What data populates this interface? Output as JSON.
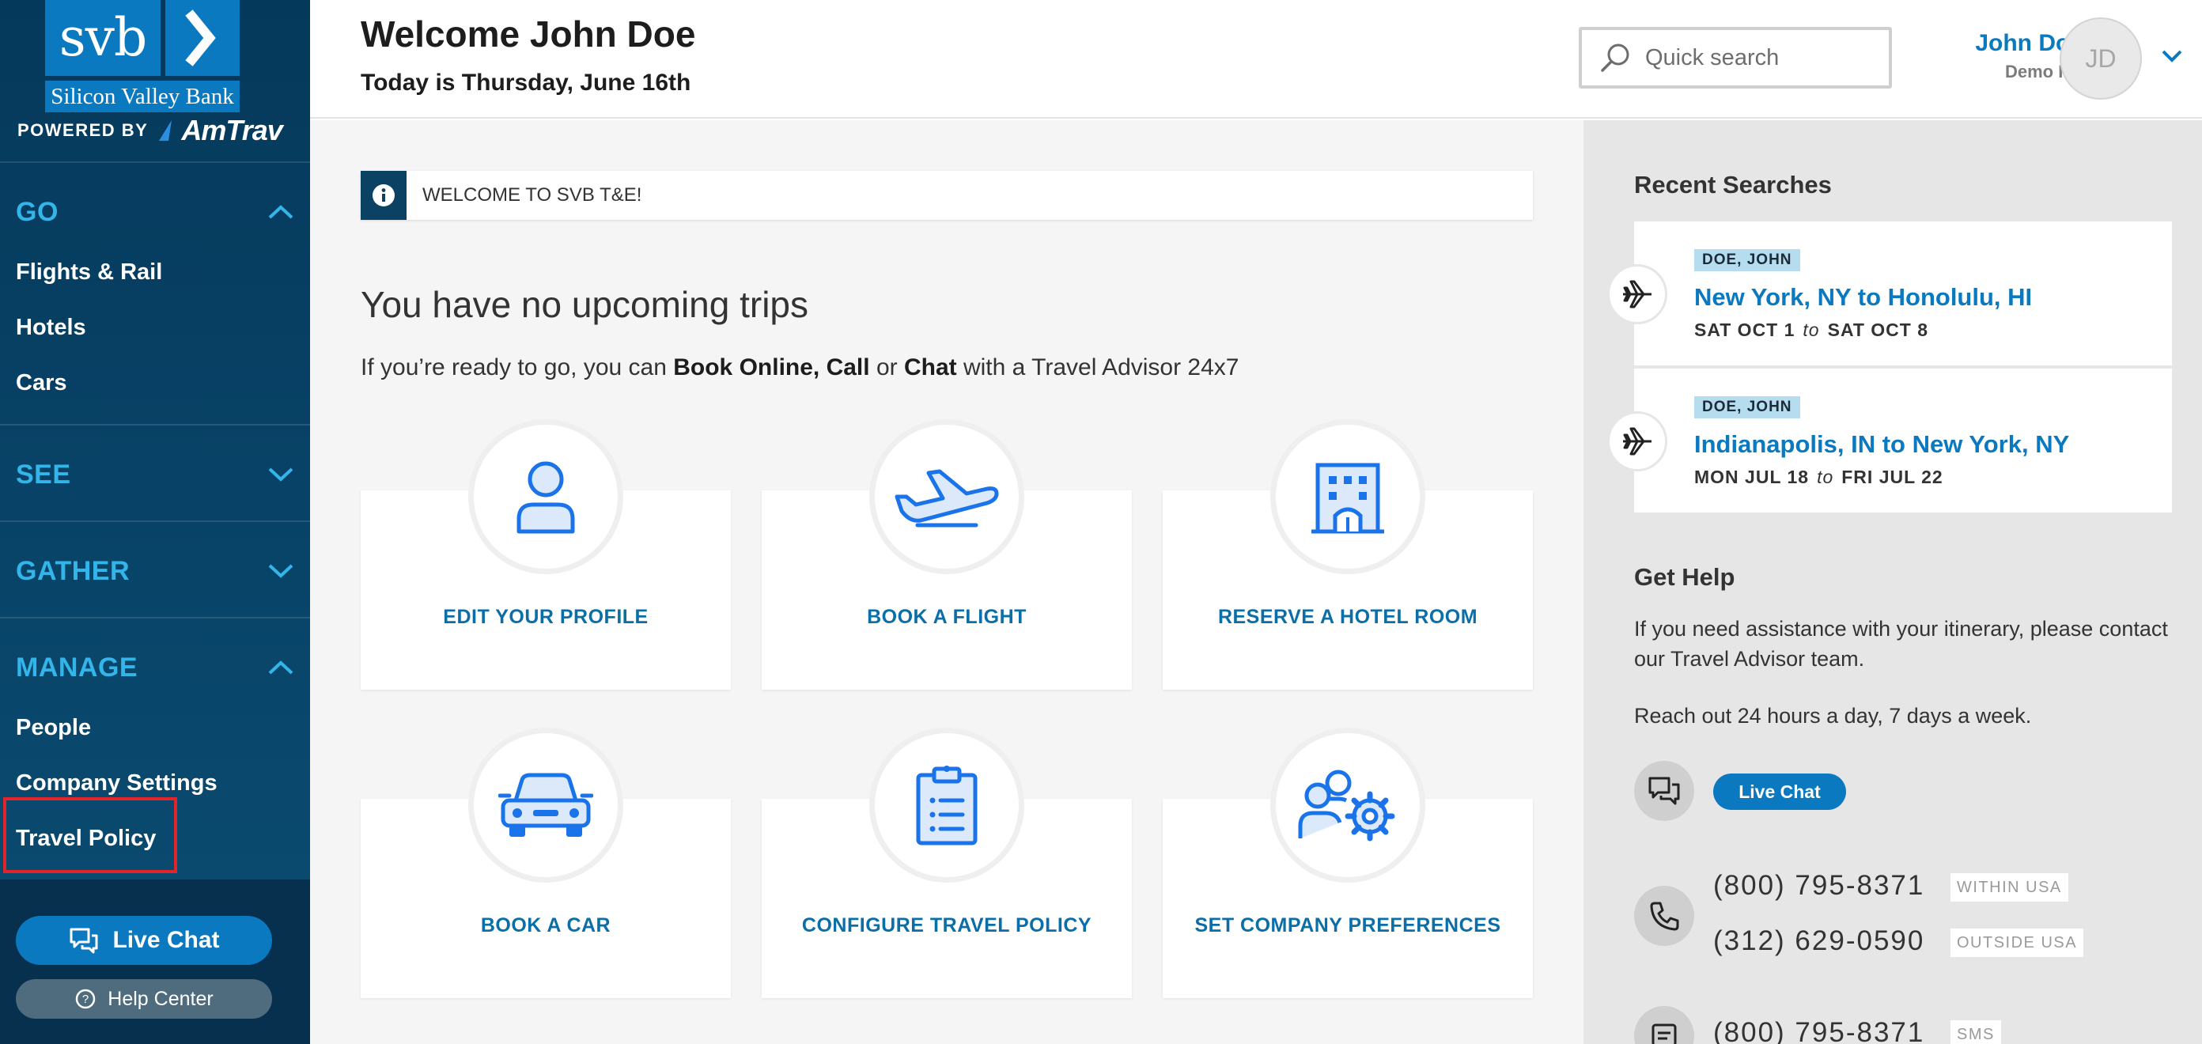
{
  "sidebar": {
    "logo": {
      "mark": "svb",
      "bank_name": "Silicon Valley Bank"
    },
    "powered_by": {
      "label": "POWERED BY",
      "brand": "AmTrav"
    },
    "sections": [
      {
        "title": "GO",
        "expanded": true,
        "items": [
          "Flights & Rail",
          "Hotels",
          "Cars"
        ]
      },
      {
        "title": "SEE",
        "expanded": false,
        "items": []
      },
      {
        "title": "GATHER",
        "expanded": false,
        "items": []
      },
      {
        "title": "MANAGE",
        "expanded": true,
        "items": [
          "People",
          "Company Settings",
          "Travel Policy"
        ]
      }
    ],
    "live_chat_label": "Live Chat",
    "help_center_label": "Help Center",
    "colors": {
      "accent": "#33b5ea",
      "highlight": "#e0262b"
    }
  },
  "header": {
    "welcome": "Welcome John Doe",
    "today": "Today is Thursday, June 16th",
    "search_placeholder": "Quick search",
    "user_name": "John Doe",
    "company": "Demo Inc",
    "avatar_initials": "JD"
  },
  "main": {
    "notice": "WELCOME TO SVB T&E!",
    "no_trips": "You have no upcoming trips",
    "ready": {
      "prefix": "If you’re ready to go, you can ",
      "bold1": "Book Online, Call",
      "mid": " or ",
      "bold2": "Chat",
      "suffix": " with a Travel Advisor 24x7"
    },
    "tiles": [
      {
        "label": "EDIT YOUR PROFILE",
        "icon": "user-icon"
      },
      {
        "label": "BOOK A FLIGHT",
        "icon": "airplane-icon"
      },
      {
        "label": "RESERVE A HOTEL ROOM",
        "icon": "hotel-icon"
      },
      {
        "label": "BOOK A CAR",
        "icon": "car-icon"
      },
      {
        "label": "CONFIGURE TRAVEL POLICY",
        "icon": "clipboard-icon"
      },
      {
        "label": "SET COMPANY PREFERENCES",
        "icon": "users-gear-icon"
      }
    ]
  },
  "right_panel": {
    "recent_title": "Recent Searches",
    "searches": [
      {
        "traveler": "DOE, JOHN",
        "route": "New York, NY to Honolulu, HI",
        "from_date": "SAT OCT 1",
        "to_word": "to",
        "to_date": "SAT OCT 8"
      },
      {
        "traveler": "DOE, JOHN",
        "route": "Indianapolis, IN to New York, NY",
        "from_date": "MON JUL 18",
        "to_word": "to",
        "to_date": "FRI JUL 22"
      }
    ],
    "help_title": "Get Help",
    "help_text": "If you need assistance with your itinerary, please contact our Travel Advisor team.",
    "reach_out": "Reach out 24 hours a day, 7 days a week.",
    "live_chat_label": "Live Chat",
    "phones": [
      {
        "number": "(800) 795-8371",
        "tag": "WITHIN USA"
      },
      {
        "number": "(312) 629-0590",
        "tag": "OUTSIDE USA"
      },
      {
        "number": "(800) 795-8371",
        "tag": "SMS"
      }
    ]
  }
}
